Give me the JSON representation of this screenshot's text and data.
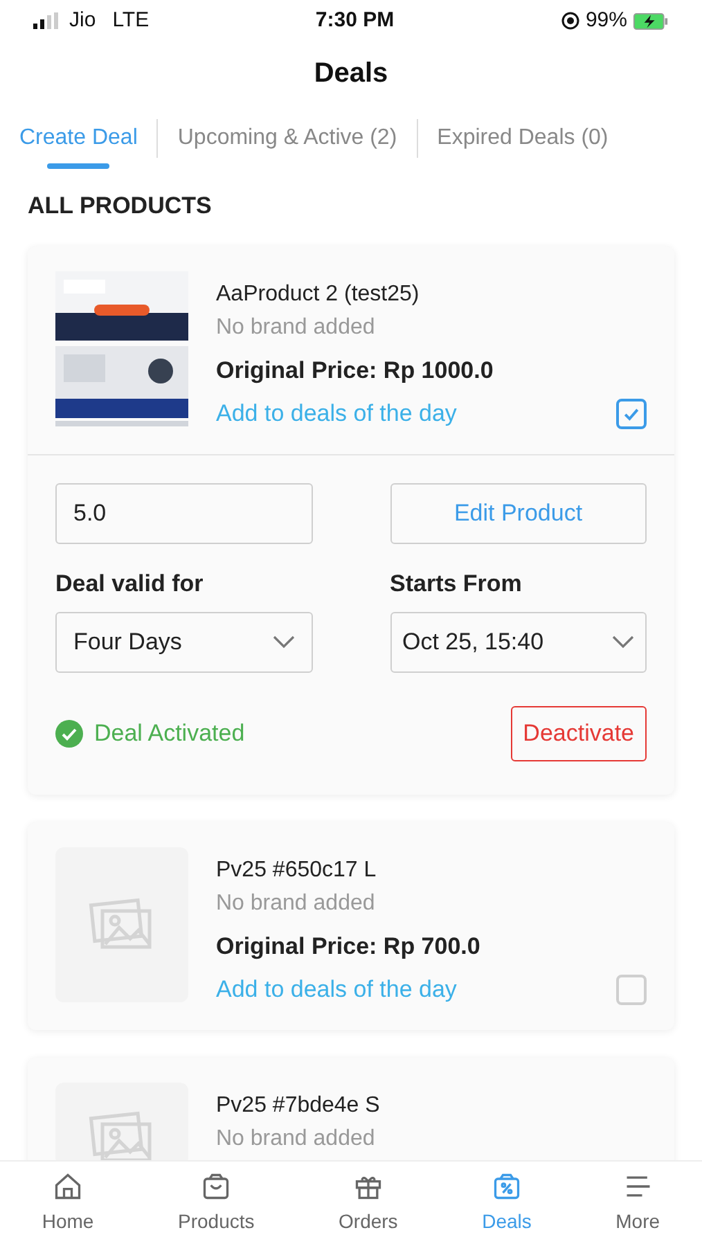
{
  "status_bar": {
    "carrier": "Jio",
    "network": "LTE",
    "time": "7:30 PM",
    "battery": "99%"
  },
  "title": "Deals",
  "tabs": [
    {
      "label": "Create Deal",
      "selected": true
    },
    {
      "label": "Upcoming & Active (2)",
      "selected": false
    },
    {
      "label": "Expired Deals (0)",
      "selected": false
    }
  ],
  "section_title": "ALL PRODUCTS",
  "products": [
    {
      "name": "AaProduct 2 (test25)",
      "brand": "No brand added",
      "price": "Original Price: Rp 1000.0",
      "deal_link": "Add to deals of the day",
      "checked": true,
      "kind": "picture",
      "expanded": true,
      "deal": {
        "price_value": "5.0",
        "edit_button": "Edit Product",
        "valid_label": "Deal valid for",
        "valid_value": "Four Days",
        "start_label": "Starts From",
        "start_value": "Oct 25, 15:40",
        "status": "Deal Activated",
        "deactivate_button": "Deactivate"
      }
    },
    {
      "name": "Pv25 #650c17 L",
      "brand": "No brand added",
      "price": "Original Price: Rp 700.0",
      "deal_link": "Add to deals of the day",
      "checked": false,
      "kind": "placeholder"
    },
    {
      "name": "Pv25 #7bde4e S",
      "brand": "No brand added",
      "kind": "placeholder"
    }
  ],
  "nav": [
    {
      "label": "Home",
      "selected": false
    },
    {
      "label": "Products",
      "selected": false
    },
    {
      "label": "Orders",
      "selected": false
    },
    {
      "label": "Deals",
      "selected": true
    },
    {
      "label": "More",
      "selected": false
    }
  ]
}
